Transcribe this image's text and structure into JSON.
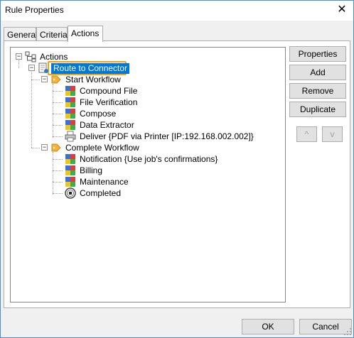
{
  "window": {
    "title": "Rule Properties",
    "close_glyph": "✕"
  },
  "tabs": [
    {
      "label": "General"
    },
    {
      "label": "Criteria"
    },
    {
      "label": "Actions"
    }
  ],
  "tree": {
    "root": "Actions",
    "route": "Route to Connector",
    "start_workflow": "Start Workflow",
    "start_items": [
      "Compound File",
      "File Verification",
      "Compose",
      "Data Extractor",
      "Deliver {PDF via Printer [IP:192.168.002.002]}"
    ],
    "complete_workflow": "Complete Workflow",
    "complete_items": [
      "Notification {Use job's confirmations}",
      "Billing",
      "Maintenance",
      "Completed"
    ],
    "expander_minus": "−"
  },
  "side_buttons": {
    "properties": "Properties",
    "add": "Add",
    "remove": "Remove",
    "duplicate": "Duplicate",
    "up": "^",
    "down": "v"
  },
  "footer": {
    "ok": "OK",
    "cancel": "Cancel"
  },
  "colors": {
    "selection": "#0078d7",
    "highlight_outline": "#f0a30a",
    "window_border": "#4a90d9"
  }
}
